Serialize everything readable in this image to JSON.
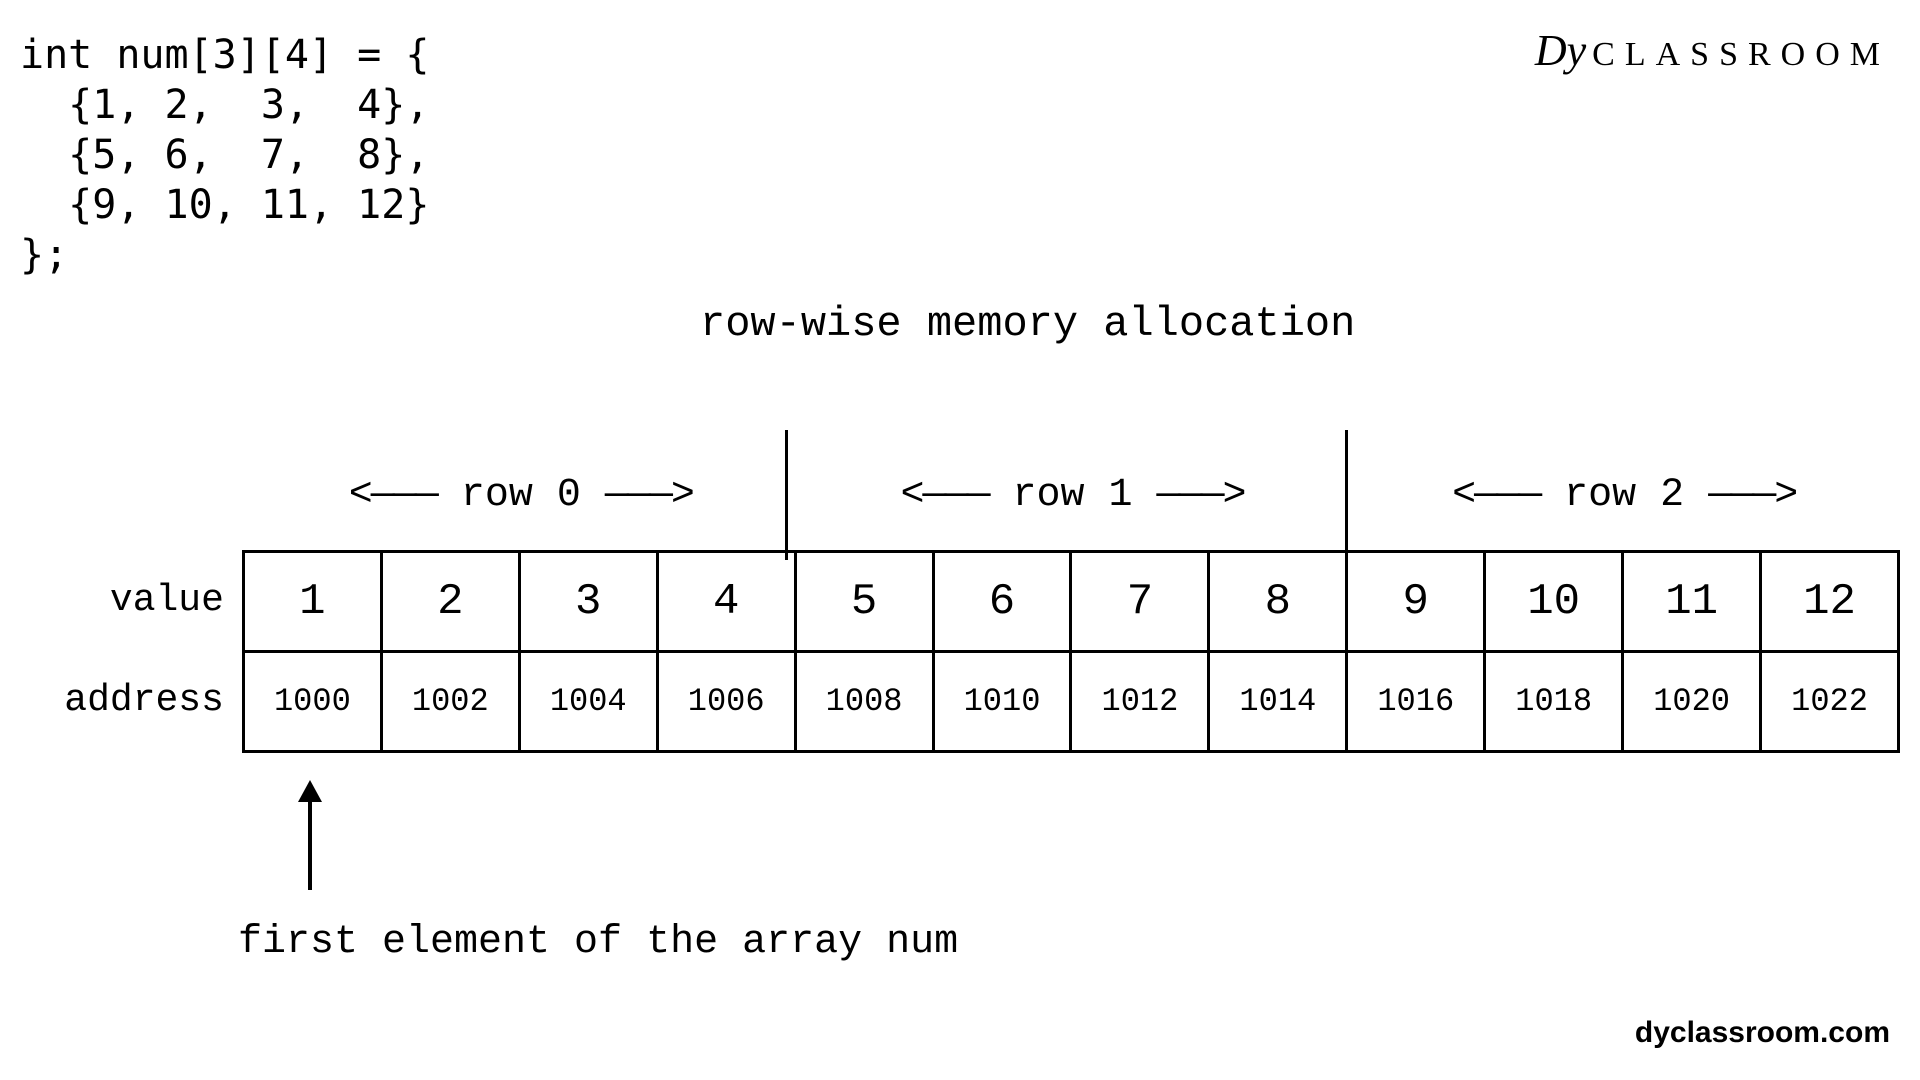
{
  "code": "int num[3][4] = {\n  {1, 2,  3,  4},\n  {5, 6,  7,  8},\n  {9, 10, 11, 12}\n};",
  "logo": {
    "script": "Dy",
    "text": "CLASSROOM"
  },
  "title": "row-wise memory allocation",
  "row_labels": {
    "r0": "row 0",
    "r1": "row 1",
    "r2": "row 2",
    "arrow_left": "<———",
    "arrow_right": "———>"
  },
  "labels": {
    "value": "value",
    "address": "address"
  },
  "chart_data": {
    "type": "table",
    "values": [
      1,
      2,
      3,
      4,
      5,
      6,
      7,
      8,
      9,
      10,
      11,
      12
    ],
    "addresses": [
      1000,
      1002,
      1004,
      1006,
      1008,
      1010,
      1012,
      1014,
      1016,
      1018,
      1020,
      1022
    ]
  },
  "caption": "first element of the array num",
  "footer": "dyclassroom.com"
}
